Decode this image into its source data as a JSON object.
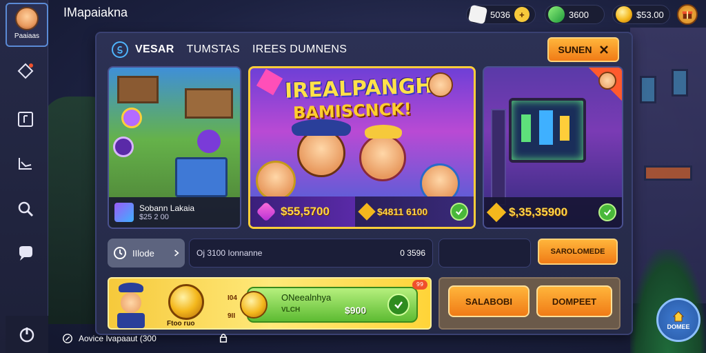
{
  "app": {
    "title": "IMapaiakna"
  },
  "profile": {
    "name": "Paaiaas"
  },
  "currencies": [
    {
      "icon": "dice-icon",
      "value": "5036",
      "color": "#f2f2f2",
      "plus_color": "#f6c93b"
    },
    {
      "icon": "emerald-icon",
      "value": "3600",
      "color": "#3fbf56",
      "plus_color": "#3fbf56"
    },
    {
      "icon": "gold-coin-icon",
      "value": "$53.00",
      "color": "#f4b81d",
      "plus_color": "#f0502b"
    }
  ],
  "panel": {
    "tabs": [
      "VESAR",
      "TUMSTAS",
      "IREES DUMNENS"
    ],
    "close_label": "SUNEN"
  },
  "cards": [
    {
      "name": "Sobann Lakaia",
      "price": "$25 2 00"
    },
    {
      "title": "IREALPANGH",
      "subtitle": "BAMISCNCK!",
      "price_primary": "$55,5700",
      "price_secondary": "$4811 6100"
    },
    {
      "price": "$,35,35900"
    }
  ],
  "search_row": {
    "mode_label": "IIlode",
    "search_placeholder": "Oj 3100 Ionnanne",
    "search_value": "0 3596",
    "submit_label": "SAROLOMEDE"
  },
  "reward": {
    "title": "ONeealnhya",
    "subtitle": "VLCH",
    "amount": "$900",
    "side_top": "I04",
    "side_bottom": "9II",
    "coin_label": "Ftoo ruo",
    "badge": "99"
  },
  "actions": {
    "left_label": "SALABOBI",
    "right_label": "DOMPEET"
  },
  "footer": {
    "note": "Aovice Ivapaaut (300"
  },
  "fab": {
    "label": "DOMEE"
  }
}
